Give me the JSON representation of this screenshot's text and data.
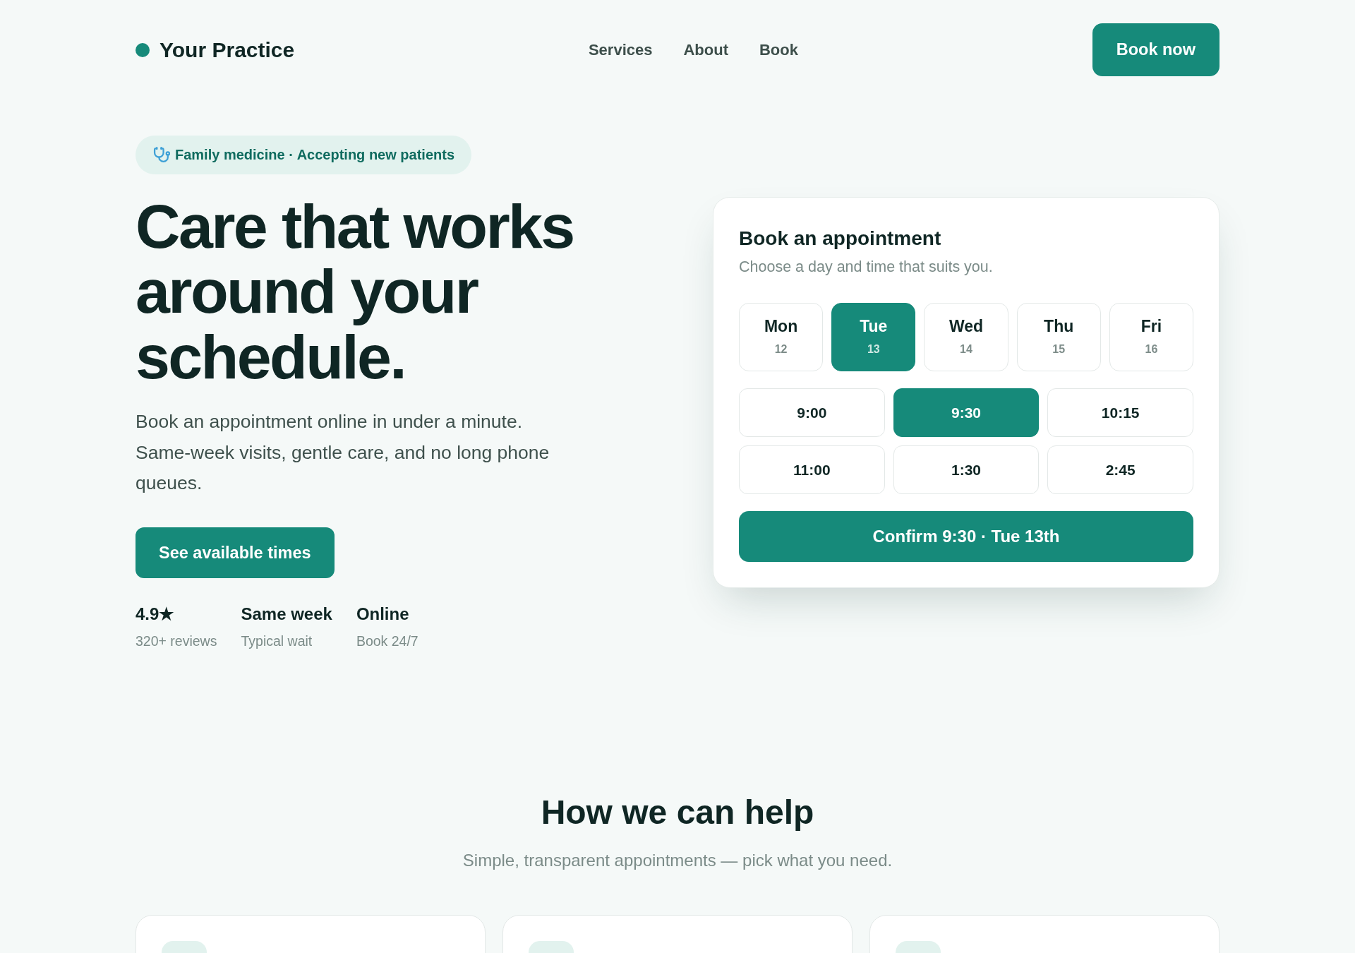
{
  "header": {
    "brand": "Your Practice",
    "nav": [
      {
        "label": "Services"
      },
      {
        "label": "About"
      },
      {
        "label": "Book"
      }
    ],
    "cta": "Book now"
  },
  "hero": {
    "badge": "Family medicine · Accepting new patients",
    "title": "Care that works around your schedule.",
    "description": "Book an appointment online in under a minute. Same-week visits, gentle care, and no long phone queues.",
    "cta": "See available times",
    "stats": [
      {
        "value": "4.9★",
        "label": "320+ reviews"
      },
      {
        "value": "Same week",
        "label": "Typical wait"
      },
      {
        "value": "Online",
        "label": "Book 24/7"
      }
    ]
  },
  "booking": {
    "title": "Book an appointment",
    "subtitle": "Choose a day and time that suits you.",
    "days": [
      {
        "day": "Mon",
        "date": "12",
        "selected": false
      },
      {
        "day": "Tue",
        "date": "13",
        "selected": true
      },
      {
        "day": "Wed",
        "date": "14",
        "selected": false
      },
      {
        "day": "Thu",
        "date": "15",
        "selected": false
      },
      {
        "day": "Fri",
        "date": "16",
        "selected": false
      }
    ],
    "times": [
      {
        "label": "9:00",
        "selected": false
      },
      {
        "label": "9:30",
        "selected": true
      },
      {
        "label": "10:15",
        "selected": false
      },
      {
        "label": "11:00",
        "selected": false
      },
      {
        "label": "1:30",
        "selected": false
      },
      {
        "label": "2:45",
        "selected": false
      }
    ],
    "confirm": "Confirm 9:30 · Tue 13th"
  },
  "help": {
    "title": "How we can help",
    "subtitle": "Simple, transparent appointments — pick what you need."
  }
}
